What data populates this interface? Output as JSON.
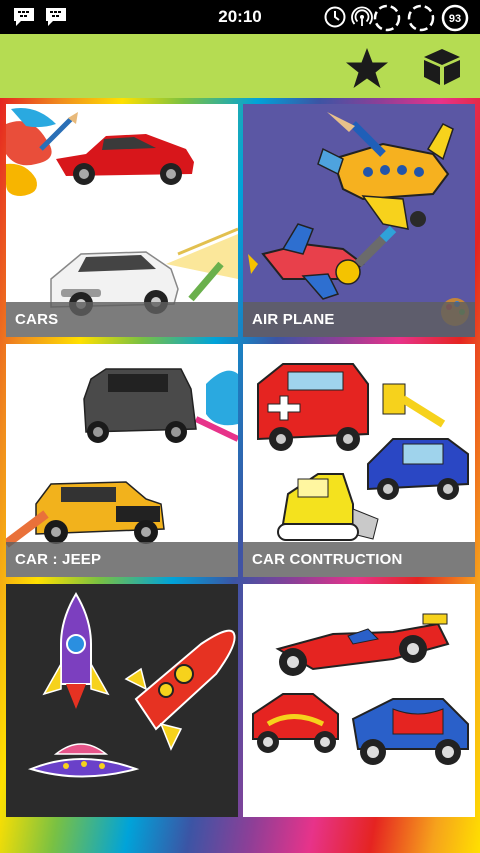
{
  "status_bar": {
    "time": "20:10",
    "battery_level": "93",
    "icons": [
      "bbm-icon",
      "bbm-icon",
      "alarm-icon",
      "hotspot-icon",
      "sync-icon",
      "sync-icon",
      "sync-icon",
      "battery-icon"
    ]
  },
  "app_bar": {
    "color": "#b5dc52",
    "actions": [
      "star-icon",
      "cube-icon"
    ]
  },
  "categories": [
    {
      "label": "CARS"
    },
    {
      "label": "AIR PLANE"
    },
    {
      "label": "CAR : JEEP"
    },
    {
      "label": "CAR CONTRUCTION"
    },
    {
      "label": ""
    },
    {
      "label": ""
    }
  ]
}
